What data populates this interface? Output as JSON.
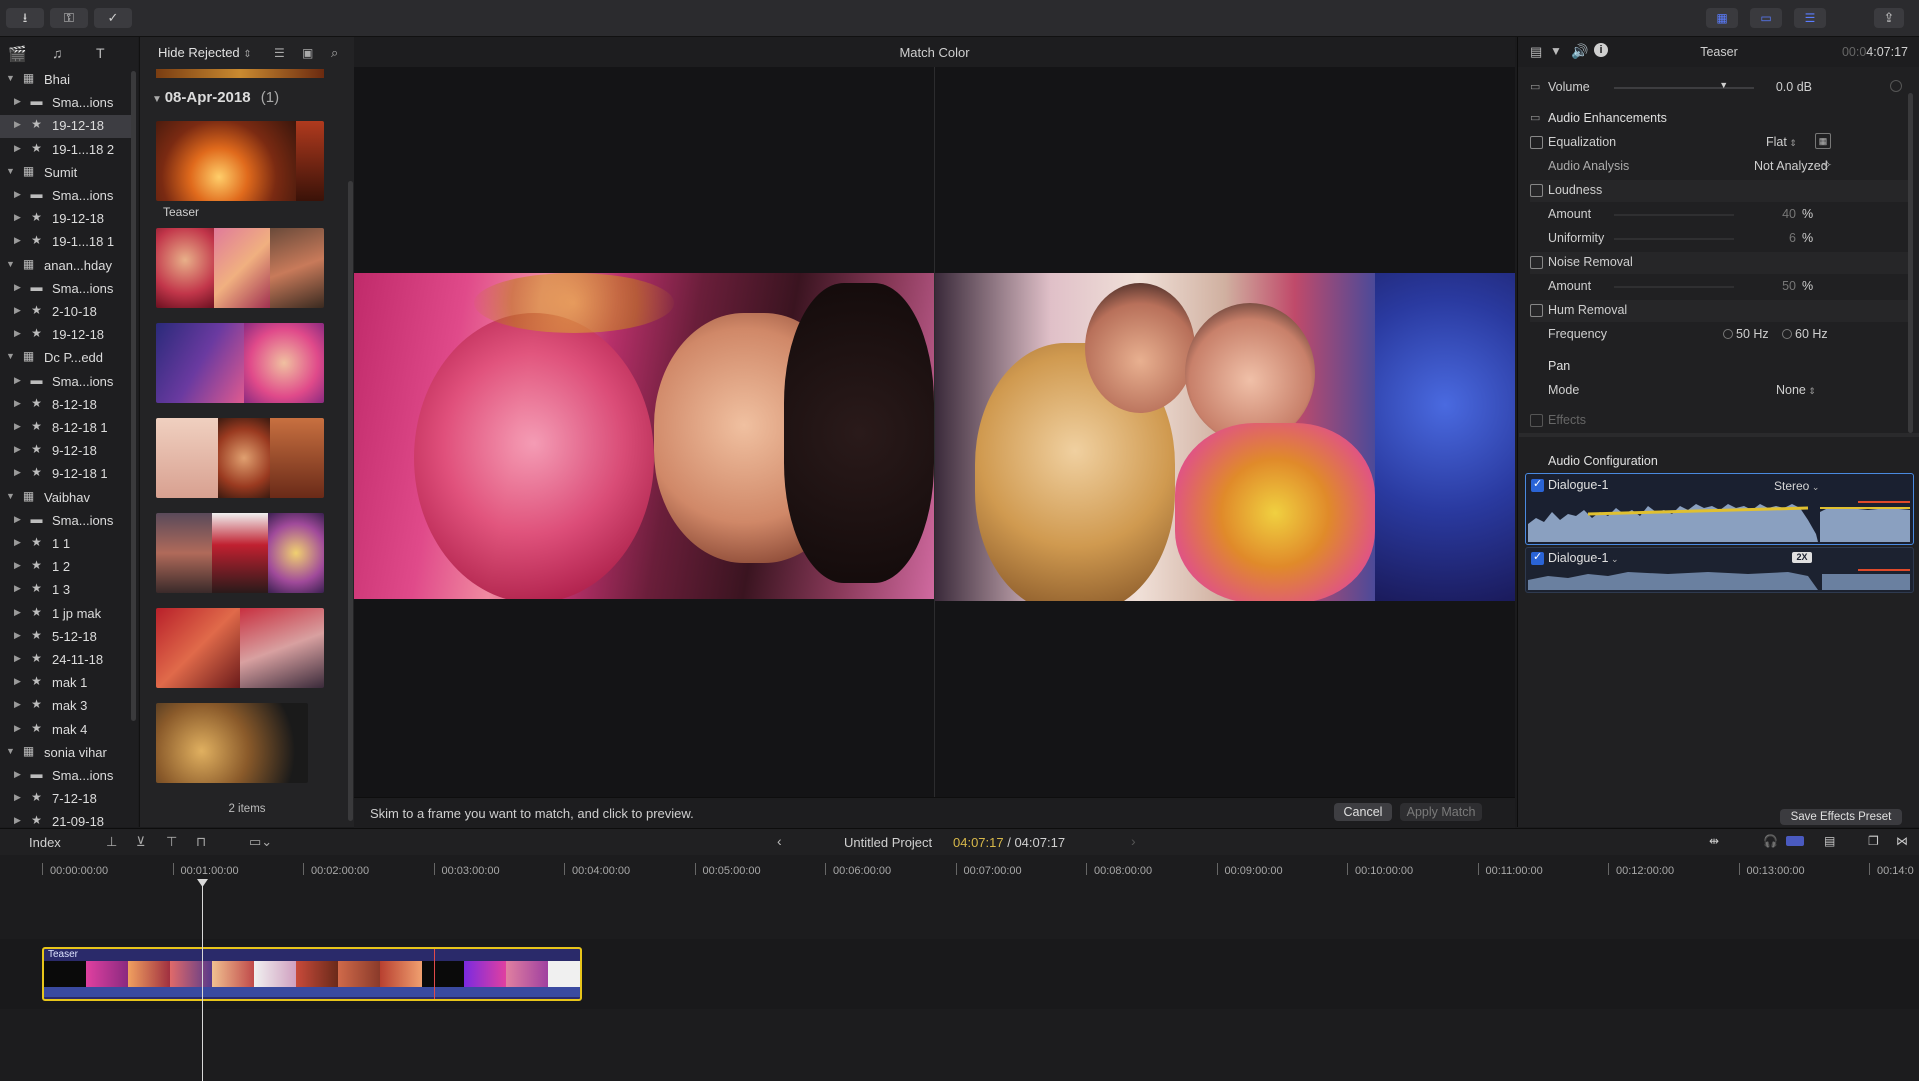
{
  "toolbar": {
    "left_buttons": [
      "import-icon",
      "key-icon",
      "checkmark-icon"
    ],
    "right_views": [
      "grid-icon",
      "filmstrip-icon",
      "inspector-icon"
    ]
  },
  "libraries": [
    {
      "label": "Bhai",
      "type": "library",
      "level": 0,
      "expanded": true
    },
    {
      "label": "Sma...ions",
      "type": "folder",
      "level": 1
    },
    {
      "label": "19-12-18",
      "type": "event",
      "level": 1,
      "selected": true
    },
    {
      "label": "19-1...18 2",
      "type": "event",
      "level": 1
    },
    {
      "label": "Sumit",
      "type": "library",
      "level": 0,
      "expanded": true
    },
    {
      "label": "Sma...ions",
      "type": "folder",
      "level": 1
    },
    {
      "label": "19-12-18",
      "type": "event",
      "level": 1
    },
    {
      "label": "19-1...18 1",
      "type": "event",
      "level": 1
    },
    {
      "label": "anan...hday",
      "type": "library",
      "level": 0,
      "expanded": true
    },
    {
      "label": "Sma...ions",
      "type": "folder",
      "level": 1
    },
    {
      "label": "2-10-18",
      "type": "event",
      "level": 1
    },
    {
      "label": "19-12-18",
      "type": "event",
      "level": 1
    },
    {
      "label": "Dc P...edd",
      "type": "library",
      "level": 0,
      "expanded": true
    },
    {
      "label": "Sma...ions",
      "type": "folder",
      "level": 1
    },
    {
      "label": "8-12-18",
      "type": "event",
      "level": 1
    },
    {
      "label": "8-12-18 1",
      "type": "event",
      "level": 1
    },
    {
      "label": "9-12-18",
      "type": "event",
      "level": 1
    },
    {
      "label": "9-12-18 1",
      "type": "event",
      "level": 1
    },
    {
      "label": "Vaibhav",
      "type": "library",
      "level": 0,
      "expanded": true
    },
    {
      "label": "Sma...ions",
      "type": "folder",
      "level": 1
    },
    {
      "label": "1 1",
      "type": "event",
      "level": 1
    },
    {
      "label": "1 2",
      "type": "event",
      "level": 1
    },
    {
      "label": "1 3",
      "type": "event",
      "level": 1
    },
    {
      "label": "1 jp mak",
      "type": "event",
      "level": 1
    },
    {
      "label": "5-12-18",
      "type": "event",
      "level": 1
    },
    {
      "label": "24-11-18",
      "type": "event",
      "level": 1
    },
    {
      "label": "mak 1",
      "type": "event",
      "level": 1
    },
    {
      "label": "mak 3",
      "type": "event",
      "level": 1
    },
    {
      "label": "mak 4",
      "type": "event",
      "level": 1
    },
    {
      "label": "sonia vihar",
      "type": "library",
      "level": 0,
      "expanded": true
    },
    {
      "label": "Sma...ions",
      "type": "folder",
      "level": 1
    },
    {
      "label": "7-12-18",
      "type": "event",
      "level": 1
    },
    {
      "label": "21-09-18",
      "type": "event",
      "level": 1
    }
  ],
  "browser": {
    "filter": "Hide Rejected",
    "group_date": "08-Apr-2018",
    "group_count": "(1)",
    "first_clip_label": "Teaser",
    "item_count": "2 items"
  },
  "viewer": {
    "title": "Match Color",
    "hint": "Skim to a frame you want to match, and click to preview.",
    "cancel": "Cancel",
    "apply": "Apply Match"
  },
  "inspector": {
    "clip_name": "Teaser",
    "timecode_dim": "00:0",
    "timecode": "4:07:17",
    "volume_label": "Volume",
    "volume_value": "0.0 dB",
    "volume_level": 0.78,
    "enh_title": "Audio Enhancements",
    "eq_label": "Equalization",
    "eq_value": "Flat",
    "analysis_label": "Audio Analysis",
    "analysis_value": "Not Analyzed",
    "loudness_label": "Loudness",
    "amount_label": "Amount",
    "loud_amount": "40",
    "uniformity_label": "Uniformity",
    "uniformity_value": "6",
    "pct": "%",
    "noise_label": "Noise Removal",
    "noise_amount": "50",
    "hum_label": "Hum Removal",
    "freq_label": "Frequency",
    "freq_50": "50 Hz",
    "freq_60": "60 Hz",
    "pan_label": "Pan",
    "mode_label": "Mode",
    "mode_value": "None",
    "effects_label": "Effects",
    "config_title": "Audio Configuration",
    "comp1_label": "Dialogue-1",
    "comp1_channel": "Stereo",
    "comp2_label": "Dialogue-1",
    "comp2_badge": "2X",
    "save_preset": "Save Effects Preset"
  },
  "timeline": {
    "index_label": "Index",
    "project": "Untitled Project",
    "tc_current": "04:07:17",
    "tc_sep": " / ",
    "tc_total": "04:07:17",
    "ruler": [
      "00:00:00:00",
      "00:01:00:00",
      "00:02:00:00",
      "00:03:00:00",
      "00:04:00:00",
      "00:05:00:00",
      "00:06:00:00",
      "00:07:00:00",
      "00:08:00:00",
      "00:09:00:00",
      "00:10:00:00",
      "00:11:00:00",
      "00:12:00:00",
      "00:13:00:00",
      "00:14:0"
    ],
    "clip_label": "Teaser"
  },
  "colors": {
    "accent": "#2a64d6",
    "selection_yellow": "#e8c51a",
    "timecode_yellow": "#d7b84a"
  }
}
